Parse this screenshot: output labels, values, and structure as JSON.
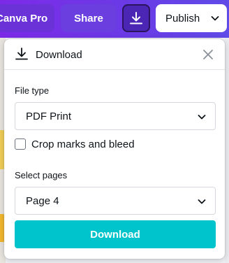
{
  "header": {
    "canva_pro_label": "Canva Pro",
    "share_label": "Share",
    "download_icon": "download-icon",
    "publish_label": "Publish"
  },
  "download_panel": {
    "title": "Download",
    "file_type_label": "File type",
    "file_type_value": "PDF Print",
    "crop_marks_label": "Crop marks and bleed",
    "crop_marks_checked": false,
    "select_pages_label": "Select pages",
    "select_pages_value": "Page 4",
    "download_button_label": "Download"
  },
  "colors": {
    "header_gradient_start": "#7d2ae8",
    "header_gradient_end": "#5f4be8",
    "primary_action": "#00c4cc",
    "text": "#0e1318"
  }
}
